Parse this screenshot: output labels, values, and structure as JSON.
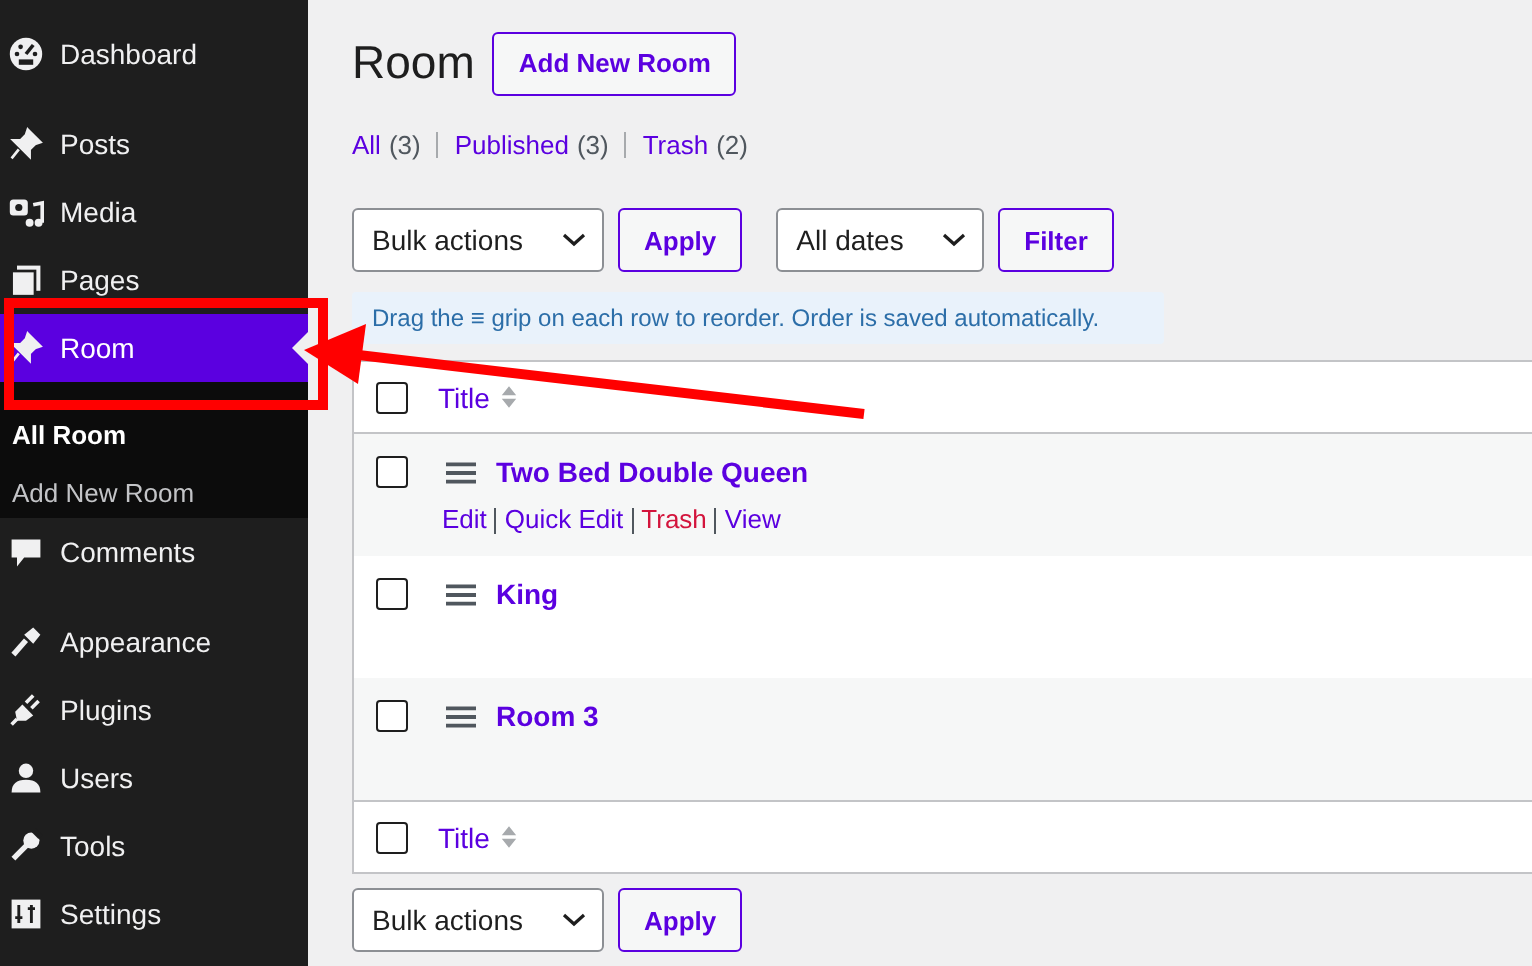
{
  "sidebar": {
    "groups": [
      [
        {
          "label": "Dashboard",
          "selected": false
        }
      ],
      [
        {
          "label": "Posts",
          "selected": false
        },
        {
          "label": "Media",
          "selected": false
        },
        {
          "label": "Pages",
          "selected": false
        },
        {
          "label": "Room",
          "selected": true,
          "children": [
            {
              "label": "All Room",
              "selected": true
            },
            {
              "label": "Add New Room",
              "selected": false
            }
          ]
        },
        {
          "label": "Comments",
          "selected": false
        }
      ],
      [
        {
          "label": "Appearance",
          "selected": false
        },
        {
          "label": "Plugins",
          "selected": false
        },
        {
          "label": "Users",
          "selected": false
        },
        {
          "label": "Tools",
          "selected": false
        },
        {
          "label": "Settings",
          "selected": false
        }
      ]
    ]
  },
  "page": {
    "title": "Room",
    "add_button": "Add New Room"
  },
  "filters": [
    {
      "label": "All",
      "count": "(3)",
      "selected": false
    },
    {
      "label": "Published",
      "count": "(3)",
      "selected": false
    },
    {
      "label": "Trash",
      "count": "(2)",
      "selected": false
    }
  ],
  "toolbar": {
    "bulk_select": "Bulk actions",
    "apply": "Apply",
    "date_select": "All dates",
    "filter": "Filter"
  },
  "notice": "Drag the ≡ grip on each row to reorder. Order is saved automatically.",
  "table": {
    "header": "Title",
    "footer": "Title",
    "header_checked": false,
    "footer_checked": false,
    "rows": [
      {
        "title": "Two Bed Double Queen",
        "checked": false,
        "actions": [
          {
            "label": "Edit",
            "kind": "link"
          },
          {
            "label": "Quick Edit",
            "kind": "link"
          },
          {
            "label": "Trash",
            "kind": "delete"
          },
          {
            "label": "View",
            "kind": "link"
          }
        ]
      },
      {
        "title": "King",
        "checked": false
      },
      {
        "title": "Room 3",
        "checked": false
      }
    ]
  },
  "bottom_toolbar": {
    "bulk_select": "Bulk actions",
    "apply": "Apply"
  }
}
